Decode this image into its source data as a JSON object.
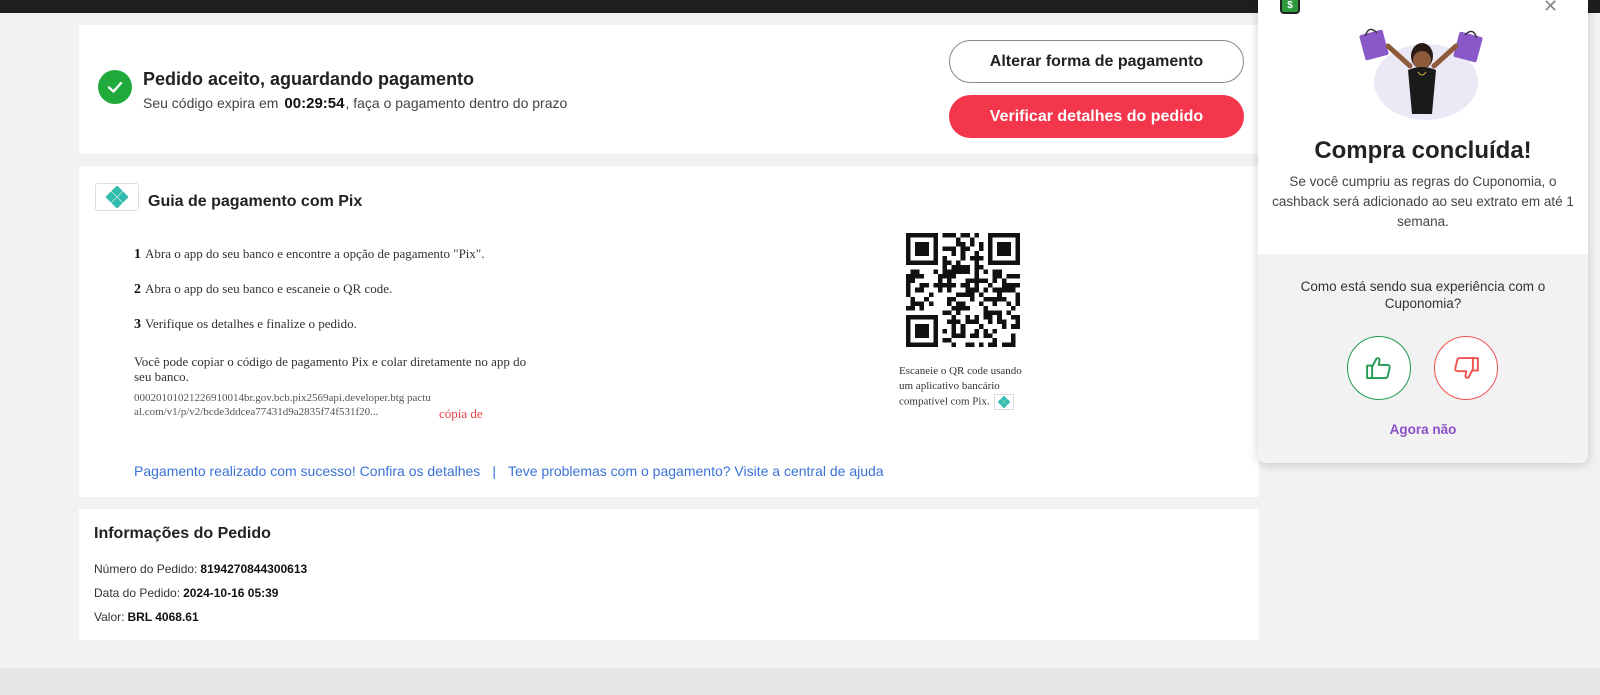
{
  "status": {
    "title": "Pedido aceito, aguardando pagamento",
    "subtitle_prefix": "Seu código expira em",
    "timer": "00:29:54",
    "subtitle_suffix": ", faça o pagamento dentro do prazo",
    "icon": "check-circle-icon",
    "change_payment_label": "Alterar forma de pagamento",
    "order_details_label": "Verificar detalhes do pedido"
  },
  "pix_guide": {
    "title": "Guia de pagamento com Pix",
    "logo_icon": "pix-icon",
    "steps": [
      {
        "num": "1",
        "text": "Abra o app do seu banco e encontre a opção de pagamento \"Pix\"."
      },
      {
        "num": "2",
        "text": "Abra o app do seu banco e escaneie o QR code."
      },
      {
        "num": "3",
        "text": "Verifique os detalhes e finalize o pedido."
      }
    ],
    "copy_note": "Você pode copiar o código de pagamento Pix e colar diretamente no app do seu banco.",
    "pix_code": "00020101021226910014br.gov.bcb.pix2569api.developer.btg pactual.com/v1/p/v2/bcde3ddcea77431d9a2835f74f531f20...",
    "copy_label": "cópia de",
    "qr_caption": "Escaneie o QR code usando um aplicativo bancário compatível com Pix.",
    "qr_icon": "qr-code-icon",
    "link_success": "Pagamento realizado com sucesso! Confira os detalhes",
    "link_separator": "|",
    "link_help": "Teve problemas com o pagamento? Visite a central de ajuda"
  },
  "order_info": {
    "title": "Informações do Pedido",
    "rows": [
      {
        "label": "Número do Pedido:",
        "value": "8194270844300613"
      },
      {
        "label": "Data do Pedido:",
        "value": "2024-10-16 05:39"
      },
      {
        "label": "Valor:",
        "value": "BRL 4068.61"
      }
    ]
  },
  "popup": {
    "app_icon": "cuponomia-icon",
    "close_icon": "close-icon",
    "title": "Compra concluída!",
    "text": "Se você cumpriu as regras do Cuponomia, o cashback será adicionado ao seu extrato em até 1 semana.",
    "question": "Como está sendo sua experiência com o Cuponomia?",
    "thumbs_up_icon": "thumbs-up-icon",
    "thumbs_down_icon": "thumbs-down-icon",
    "later_label": "Agora não"
  },
  "colors": {
    "primary_button": "#f4364c",
    "success": "#1faa3b",
    "link": "#3a72d8",
    "copy_link": "#e84040",
    "pix_teal": "#32bcad",
    "popup_later": "#8b4fc9",
    "thumb_up": "#1f9a52",
    "thumb_down": "#ef5350"
  }
}
